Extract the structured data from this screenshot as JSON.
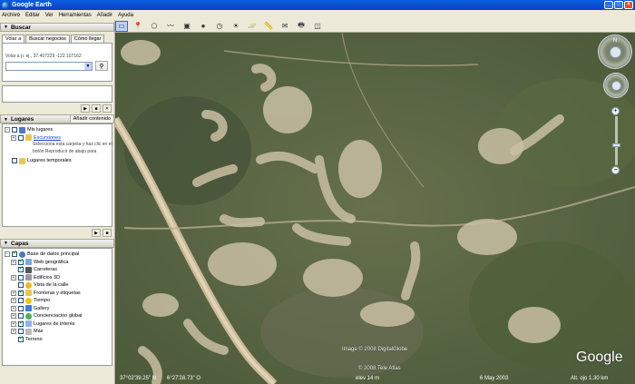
{
  "window": {
    "title": "Google Earth"
  },
  "menu": [
    "Archivo",
    "Editar",
    "Ver",
    "Herramientas",
    "Añadir",
    "Ayuda"
  ],
  "search": {
    "header": "Buscar",
    "tabs": [
      "Volar a",
      "Buscar negocios",
      "Cómo llegar"
    ],
    "hint_label": "Volar a",
    "hint_example": "p. ej., 37.407229 -122.107162"
  },
  "places": {
    "header": "Lugares",
    "add_content": "Añadir contenido",
    "items": {
      "my_places": "Mis lugares",
      "excursions": "Excursiones",
      "excursions_help": "Selecciona esta carpeta y haz clic en el botón Reproducir de abajo para",
      "temp_places": "Lugares temporales"
    }
  },
  "layers": {
    "header": "Capas",
    "root": "Base de datos principal",
    "items": [
      "Web geográfica",
      "Carreteras",
      "Edificios 3D",
      "Vista de la calle",
      "Fronteras y etiquetas",
      "Tiempo",
      "Gallery",
      "Concienciación global",
      "Lugares de interés",
      "Más",
      "Terreno"
    ]
  },
  "map": {
    "copyright_1": "Image © 2008 DigitalGlobe",
    "copyright_2": "© 2008 Tele Atlas",
    "logo": "Google"
  },
  "status": {
    "lat": "37°02'39.25\" N",
    "lon": "6°27'28.73\" O",
    "elev": "elev   14 m",
    "date": "6 May 2003",
    "eye_alt": "Alt. ojo   1.30 km"
  },
  "colors": {
    "titlebar": "#0a4fd8",
    "panel_bg": "#ece9d8",
    "link": "#1a3fcf",
    "terrain": "#5f6e48"
  }
}
